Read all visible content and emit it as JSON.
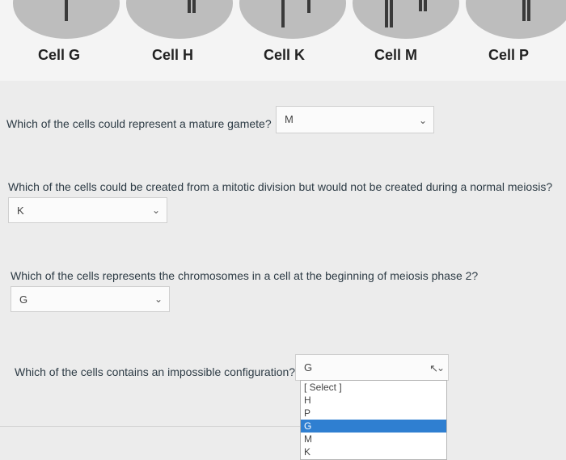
{
  "cells": [
    {
      "name": "Cell G"
    },
    {
      "name": "Cell H"
    },
    {
      "name": "Cell K"
    },
    {
      "name": "Cell M"
    },
    {
      "name": "Cell P"
    }
  ],
  "questions": [
    {
      "text": "Which of the cells could represent a mature gamete?",
      "answer": "M"
    },
    {
      "text": "Which of the cells could be created from a mitotic division but would not be created during a normal meiosis?",
      "answer": "K"
    },
    {
      "text": "Which of the cells represents the chromosomes in a cell at the beginning of meiosis phase 2?",
      "answer": "G"
    },
    {
      "text": "Which of the cells contains an impossible configuration?",
      "answer": "G"
    }
  ],
  "dropdown": {
    "options": [
      "[ Select ]",
      "H",
      "P",
      "G",
      "M",
      "K"
    ],
    "highlighted": "G"
  },
  "icons": {
    "chevron": "chevron-down-icon",
    "pointer": "mouse-pointer-icon"
  },
  "colors": {
    "highlight": "#2f7fd1",
    "text": "#2d3b45"
  }
}
